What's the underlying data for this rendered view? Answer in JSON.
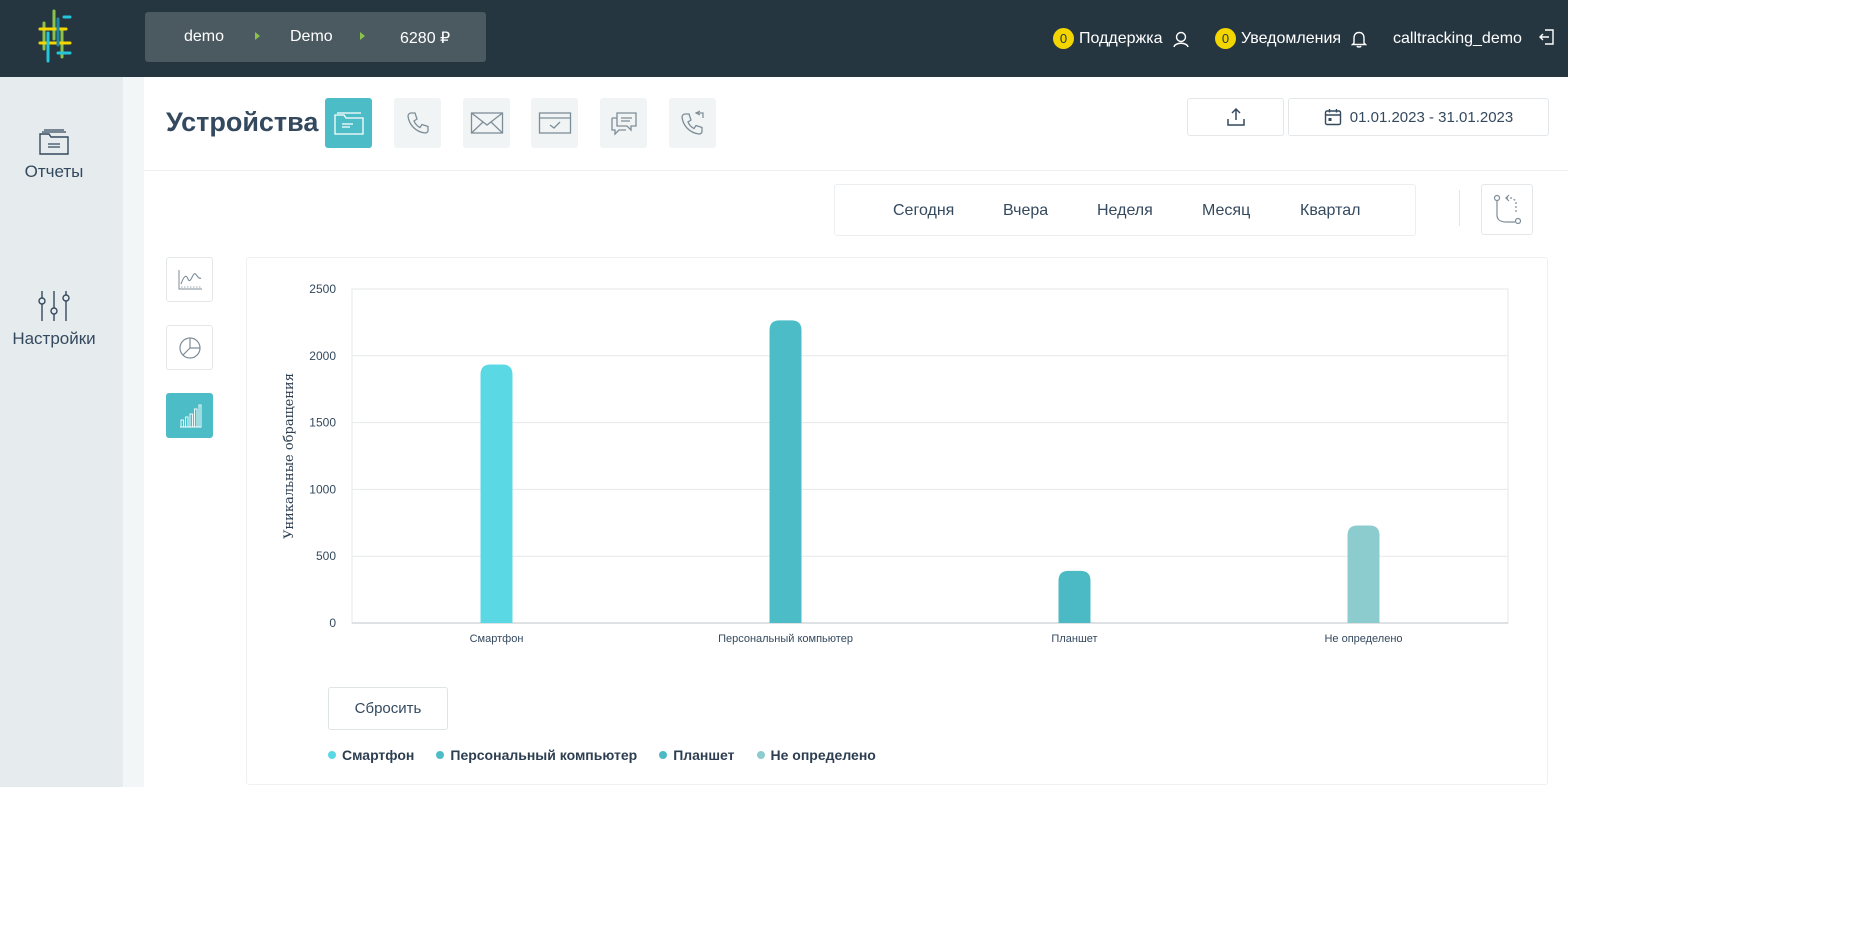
{
  "header": {
    "breadcrumbs": [
      "demo",
      "Demo",
      "6280 ₽"
    ],
    "support": {
      "count": "0",
      "label": "Поддержка",
      "icon": "support-icon"
    },
    "notifications": {
      "count": "0",
      "label": "Уведомления",
      "icon": "bell-icon"
    },
    "user": "calltracking_demo",
    "logout_icon": "logout-icon"
  },
  "sidebar": {
    "items": [
      {
        "label": "Отчеты",
        "icon": "folder-icon"
      },
      {
        "label": "Настройки",
        "icon": "sliders-icon"
      }
    ]
  },
  "page": {
    "title": "Устройства",
    "type_buttons": [
      "folder-icon",
      "phone-icon",
      "envelope-icon",
      "form-icon",
      "chat-icon",
      "callback-icon"
    ],
    "date_range": "01.01.2023 - 31.01.2023"
  },
  "periods": [
    "Сегодня",
    "Вчера",
    "Неделя",
    "Месяц",
    "Квартал"
  ],
  "reset_label": "Сбросить",
  "colors": {
    "accent": "#4cbdc6",
    "topbar": "#263640",
    "badge": "#f3d600"
  },
  "chart_data": {
    "type": "bar",
    "categories": [
      "Смартфон",
      "Персональный компьютер",
      "Планшет",
      "Не определено"
    ],
    "values": [
      1935,
      2265,
      390,
      730
    ],
    "colors": [
      "#5ad9e4",
      "#4cbdc6",
      "#4cbac4",
      "#8ccccf"
    ],
    "ylabel": "Уникальные обращения",
    "ylim": [
      0,
      2500
    ],
    "yticks": [
      0,
      500,
      1000,
      1500,
      2000,
      2500
    ],
    "grid": true,
    "legend": [
      "Смартфон",
      "Персональный компьютер",
      "Планшет",
      "Не определено"
    ],
    "legend_position": "bottom-left"
  }
}
